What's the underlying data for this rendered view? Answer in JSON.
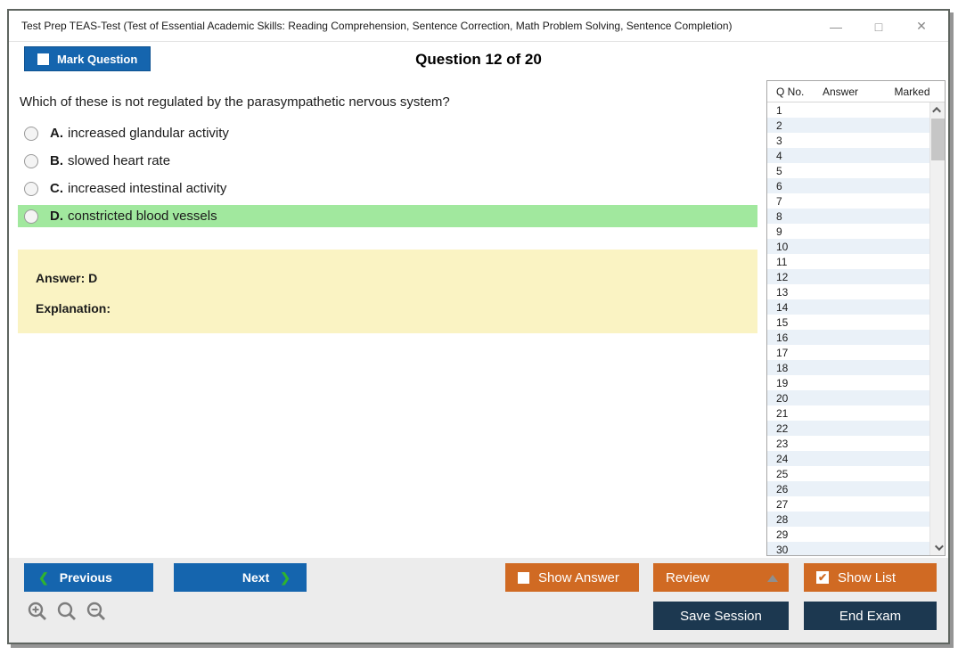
{
  "window": {
    "title": "Test Prep TEAS-Test (Test of Essential Academic Skills: Reading Comprehension, Sentence Correction, Math Problem Solving, Sentence Completion)",
    "controls": {
      "minimize": "—",
      "maximize": "□",
      "close": "✕"
    }
  },
  "header": {
    "mark_question_label": "Mark Question",
    "question_counter": "Question 12 of 20"
  },
  "question": {
    "text": "Which of these is not regulated by the parasympathetic nervous system?",
    "options": [
      {
        "letter": "A.",
        "text": "increased glandular activity",
        "highlighted": false
      },
      {
        "letter": "B.",
        "text": "slowed heart rate",
        "highlighted": false
      },
      {
        "letter": "C.",
        "text": "increased intestinal activity",
        "highlighted": false
      },
      {
        "letter": "D.",
        "text": "constricted blood vessels",
        "highlighted": true
      }
    ]
  },
  "answer_box": {
    "answer_label": "Answer: D",
    "explanation_label": "Explanation:"
  },
  "question_list": {
    "columns": [
      "Q No.",
      "Answer",
      "Marked"
    ],
    "rows": [
      {
        "q": "1",
        "answer": "",
        "marked": ""
      },
      {
        "q": "2",
        "answer": "",
        "marked": ""
      },
      {
        "q": "3",
        "answer": "",
        "marked": ""
      },
      {
        "q": "4",
        "answer": "",
        "marked": ""
      },
      {
        "q": "5",
        "answer": "",
        "marked": ""
      },
      {
        "q": "6",
        "answer": "",
        "marked": ""
      },
      {
        "q": "7",
        "answer": "",
        "marked": ""
      },
      {
        "q": "8",
        "answer": "",
        "marked": ""
      },
      {
        "q": "9",
        "answer": "",
        "marked": ""
      },
      {
        "q": "10",
        "answer": "",
        "marked": ""
      },
      {
        "q": "11",
        "answer": "",
        "marked": ""
      },
      {
        "q": "12",
        "answer": "",
        "marked": ""
      },
      {
        "q": "13",
        "answer": "",
        "marked": ""
      },
      {
        "q": "14",
        "answer": "",
        "marked": ""
      },
      {
        "q": "15",
        "answer": "",
        "marked": ""
      },
      {
        "q": "16",
        "answer": "",
        "marked": ""
      },
      {
        "q": "17",
        "answer": "",
        "marked": ""
      },
      {
        "q": "18",
        "answer": "",
        "marked": ""
      },
      {
        "q": "19",
        "answer": "",
        "marked": ""
      },
      {
        "q": "20",
        "answer": "",
        "marked": ""
      },
      {
        "q": "21",
        "answer": "",
        "marked": ""
      },
      {
        "q": "22",
        "answer": "",
        "marked": ""
      },
      {
        "q": "23",
        "answer": "",
        "marked": ""
      },
      {
        "q": "24",
        "answer": "",
        "marked": ""
      },
      {
        "q": "25",
        "answer": "",
        "marked": ""
      },
      {
        "q": "26",
        "answer": "",
        "marked": ""
      },
      {
        "q": "27",
        "answer": "",
        "marked": ""
      },
      {
        "q": "28",
        "answer": "",
        "marked": ""
      },
      {
        "q": "29",
        "answer": "",
        "marked": ""
      },
      {
        "q": "30",
        "answer": "",
        "marked": ""
      }
    ]
  },
  "footer": {
    "previous_label": "Previous",
    "next_label": "Next",
    "prev_chevron": "❮",
    "next_chevron": "❯",
    "show_answer_label": "Show Answer",
    "review_label": "Review",
    "show_list_label": "Show List",
    "show_list_check": "✔",
    "save_session_label": "Save Session",
    "end_exam_label": "End Exam"
  },
  "colors": {
    "accent_blue": "#1565AE",
    "accent_orange": "#D06A23",
    "navy": "#1C3850",
    "highlight_green": "#A1E89E",
    "answer_yellow": "#FAF3C3",
    "chevron_green": "#2FB32F",
    "row_alt_blue": "#EAF1F8"
  }
}
